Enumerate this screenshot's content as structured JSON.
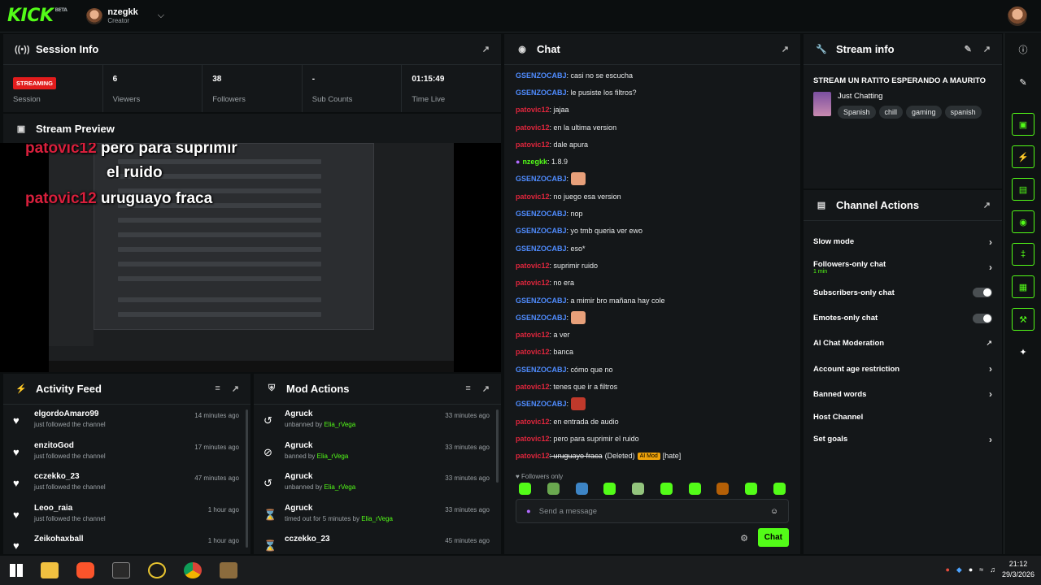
{
  "topbar": {
    "logo": "KICK",
    "logo_sup": "BETA",
    "username": "nzegkk",
    "role": "Creator"
  },
  "session": {
    "title": "Session Info",
    "status": "STREAMING",
    "status_label": "Session",
    "viewers": "6",
    "viewers_label": "Viewers",
    "followers": "38",
    "followers_label": "Followers",
    "subs": "-",
    "subs_label": "Sub Counts",
    "time": "01:15:49",
    "time_label": "Time Live"
  },
  "preview": {
    "title": "Stream Preview",
    "overlay": [
      {
        "user": "patovic12",
        "text": "pero para suprimir"
      },
      {
        "user": "",
        "text": "el ruido"
      },
      {
        "user": "patovic12",
        "text": "uruguayo fraca"
      }
    ]
  },
  "activity": {
    "title": "Activity Feed",
    "items": [
      {
        "name": "elgordoAmaro99",
        "desc": "just followed the channel",
        "time": "14 minutes ago"
      },
      {
        "name": "enzitoGod",
        "desc": "just followed the channel",
        "time": "17 minutes ago"
      },
      {
        "name": "cczekko_23",
        "desc": "just followed the channel",
        "time": "47 minutes ago"
      },
      {
        "name": "Leoo_raia",
        "desc": "just followed the channel",
        "time": "1 hour ago"
      },
      {
        "name": "Zeikohaxball",
        "desc": "",
        "time": "1 hour ago"
      }
    ]
  },
  "mod": {
    "title": "Mod Actions",
    "items": [
      {
        "name": "Agruck",
        "desc": "unbanned by",
        "by": "Elia_rVega",
        "time": "33 minutes ago",
        "icon": "undo"
      },
      {
        "name": "Agruck",
        "desc": "banned by",
        "by": "Elia_rVega",
        "time": "33 minutes ago",
        "icon": "ban"
      },
      {
        "name": "Agruck",
        "desc": "unbanned by",
        "by": "Elia_rVega",
        "time": "33 minutes ago",
        "icon": "undo"
      },
      {
        "name": "Agruck",
        "desc": "timed out for 5 minutes by",
        "by": "Elia_rVega",
        "time": "33 minutes ago",
        "icon": "hourglass"
      },
      {
        "name": "cczekko_23",
        "desc": "",
        "by": "",
        "time": "45 minutes ago",
        "icon": "hourglass"
      }
    ]
  },
  "chat": {
    "title": "Chat",
    "messages": [
      {
        "user": "GSENZOCABJ",
        "color": "blue",
        "text": ": casi no se escucha"
      },
      {
        "user": "GSENZOCABJ",
        "color": "blue",
        "text": ": le pusiste los filtros?"
      },
      {
        "user": "patovic12",
        "color": "red",
        "text": ": jajaa"
      },
      {
        "user": "patovic12",
        "color": "red",
        "text": ": en la ultima version"
      },
      {
        "user": "patovic12",
        "color": "red",
        "text": ": dale apura"
      },
      {
        "user": "nzegkk",
        "color": "green",
        "text": ": 1.8.9",
        "mic": true
      },
      {
        "user": "GSENZOCABJ",
        "color": "blue",
        "text": ":",
        "emote": "#e8a07a"
      },
      {
        "user": "patovic12",
        "color": "red",
        "text": ": no juego esa version"
      },
      {
        "user": "GSENZOCABJ",
        "color": "blue",
        "text": ": nop"
      },
      {
        "user": "GSENZOCABJ",
        "color": "blue",
        "text": ": yo tmb queria ver ewo"
      },
      {
        "user": "GSENZOCABJ",
        "color": "blue",
        "text": ": eso*"
      },
      {
        "user": "patovic12",
        "color": "red",
        "text": ": suprimir ruido"
      },
      {
        "user": "patovic12",
        "color": "red",
        "text": ": no era"
      },
      {
        "user": "GSENZOCABJ",
        "color": "blue",
        "text": ": a mimir bro mañana hay cole"
      },
      {
        "user": "GSENZOCABJ",
        "color": "blue",
        "text": ":",
        "emote": "#e8a07a"
      },
      {
        "user": "patovic12",
        "color": "red",
        "text": ": a ver"
      },
      {
        "user": "patovic12",
        "color": "red",
        "text": ": banca"
      },
      {
        "user": "GSENZOCABJ",
        "color": "blue",
        "text": ": cómo que no"
      },
      {
        "user": "patovic12",
        "color": "red",
        "text": ": tenes que ir a filtros"
      },
      {
        "user": "GSENZOCABJ",
        "color": "blue",
        "text": ":",
        "emote": "#c0392b"
      },
      {
        "user": "patovic12",
        "color": "red",
        "text": ": en entrada de audio"
      },
      {
        "user": "patovic12",
        "color": "red",
        "text": ": pero para suprimir el ruido"
      },
      {
        "user": "patovic12",
        "color": "red",
        "text": ": uruguayo fraca",
        "deleted": "(Deleted)",
        "ai": "AI Mod",
        "reason": "[hate]"
      }
    ],
    "followers_only": "Followers only",
    "placeholder": "Send a message",
    "send": "Chat"
  },
  "stream_info": {
    "title": "Stream info",
    "stream_title": "STREAM UN RATITO ESPERANDO A MAURITO",
    "category": "Just Chatting",
    "tags": [
      "Spanish",
      "chill",
      "gaming",
      "spanish"
    ]
  },
  "channel_actions": {
    "title": "Channel Actions",
    "items": [
      {
        "label": "Slow mode",
        "kind": "arrow"
      },
      {
        "label": "Followers-only chat",
        "sub": "1 min",
        "kind": "arrow"
      },
      {
        "label": "Subscribers-only chat",
        "kind": "toggle"
      },
      {
        "label": "Emotes-only chat",
        "kind": "toggle"
      },
      {
        "label": "AI Chat Moderation",
        "kind": "external"
      },
      {
        "label": "Account age restriction",
        "kind": "arrow"
      },
      {
        "label": "Banned words",
        "kind": "arrow"
      },
      {
        "label": "Host Channel",
        "kind": "none"
      },
      {
        "label": "Set goals",
        "kind": "arrow"
      }
    ]
  },
  "taskbar": {
    "time": "21:12",
    "date": "29/3/2026"
  },
  "colors": {
    "accent": "#53fc18",
    "live": "#e21c1c",
    "panel": "#141719"
  }
}
